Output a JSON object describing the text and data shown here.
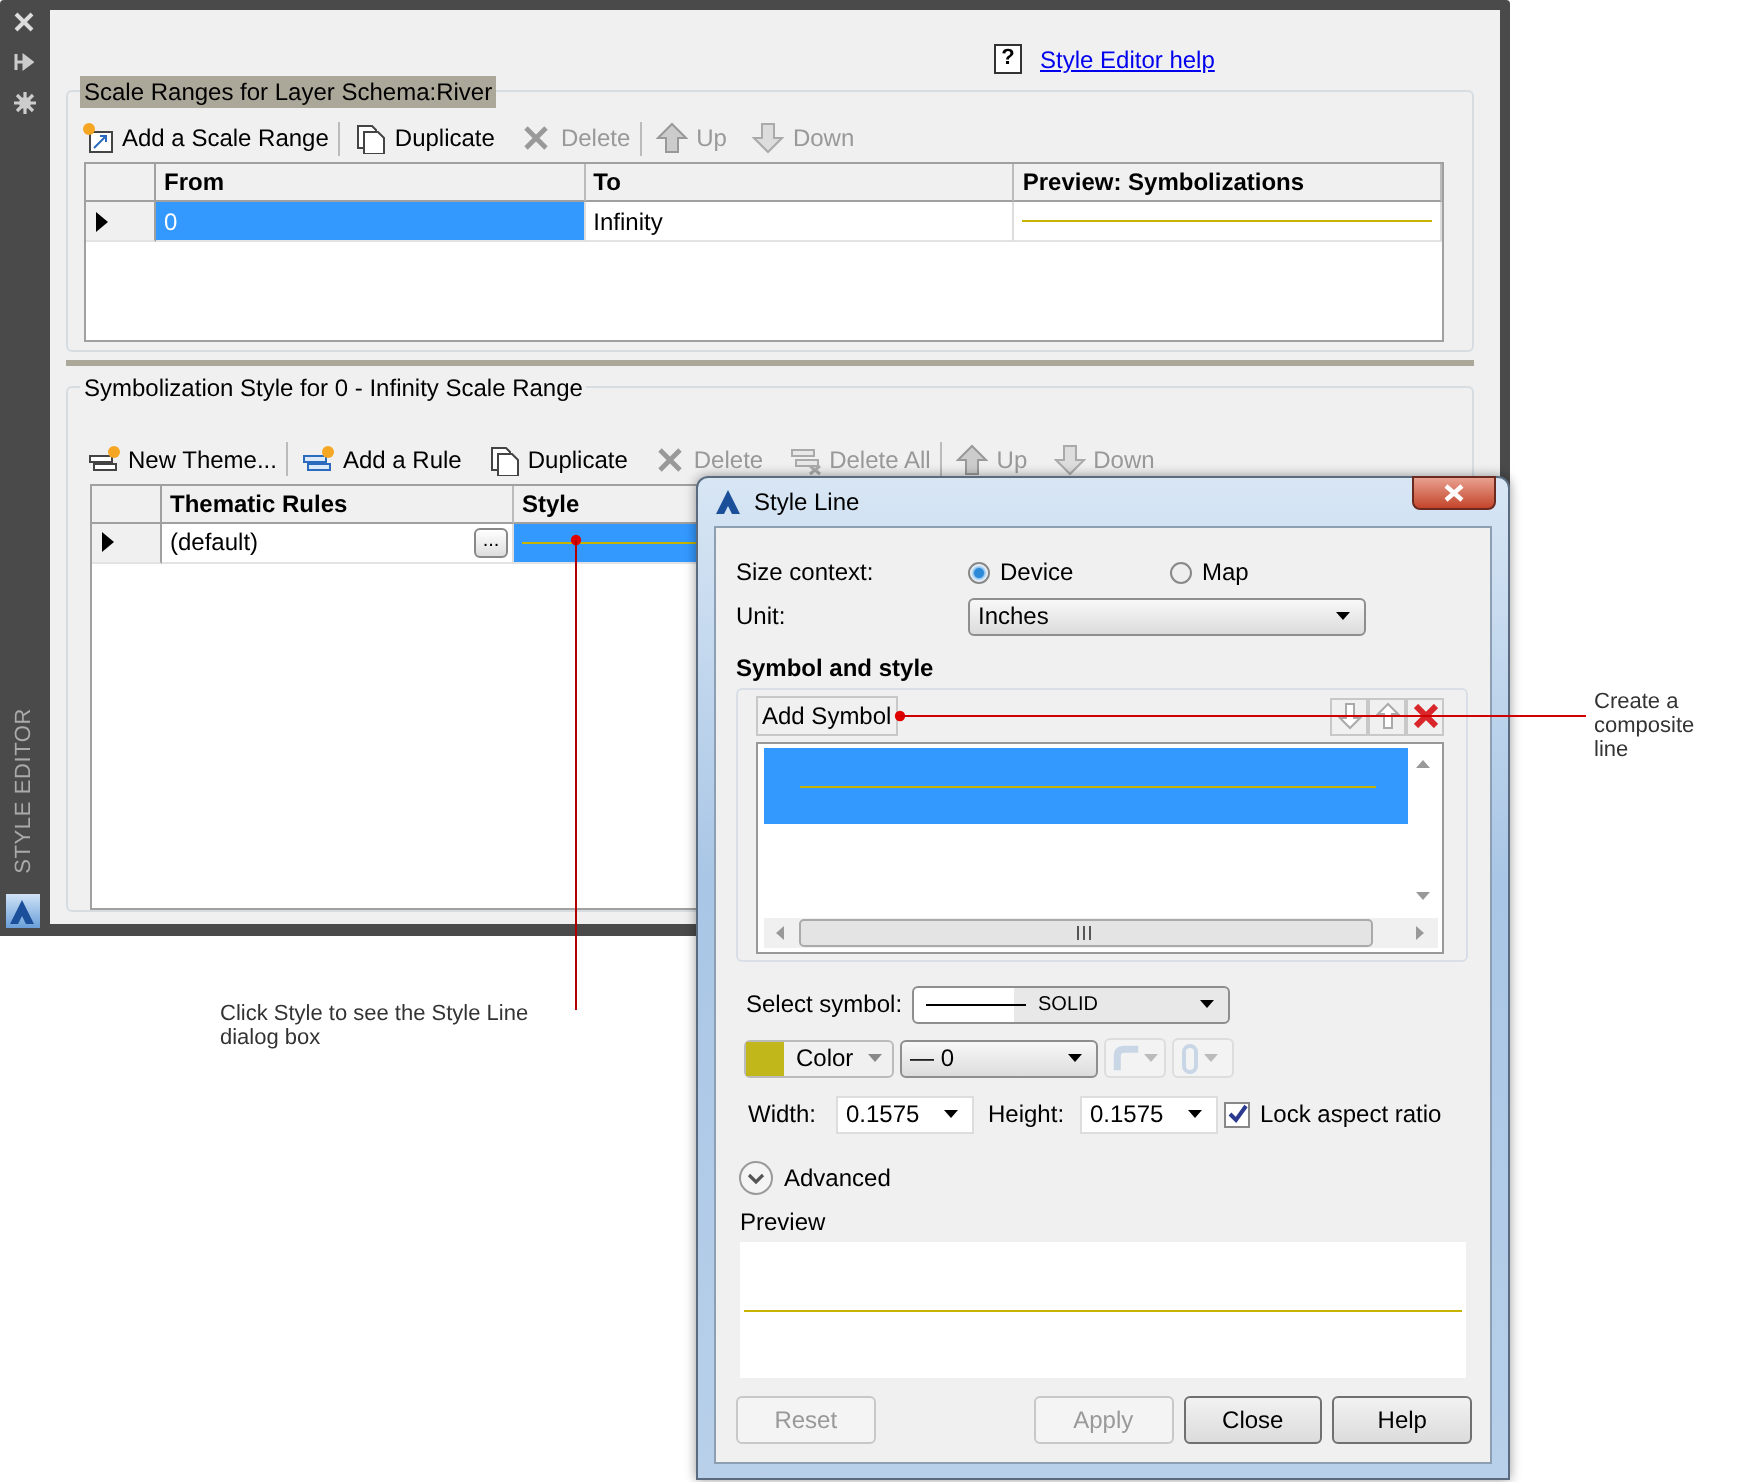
{
  "side_strip": {
    "label": "STYLE EDITOR"
  },
  "help": {
    "icon": "?",
    "link": "Style Editor help"
  },
  "scale_ranges": {
    "title": "Scale Ranges for Layer Schema:River",
    "toolbar": [
      {
        "kind": "add_range",
        "label": "Add a Scale Range",
        "disabled": false,
        "separator_after": true
      },
      {
        "kind": "duplicate",
        "label": "Duplicate",
        "disabled": false,
        "separator_after": false
      },
      {
        "kind": "delete",
        "label": "Delete",
        "disabled": true,
        "separator_after": true
      },
      {
        "kind": "up",
        "label": "Up",
        "disabled": true,
        "separator_after": false
      },
      {
        "kind": "down",
        "label": "Down",
        "disabled": true,
        "separator_after": false
      }
    ],
    "columns": [
      "From",
      "To",
      "Preview: Symbolizations"
    ],
    "rows": [
      {
        "selected": true,
        "cells": [
          {
            "kind": "text",
            "text": "0",
            "selected": true
          },
          {
            "kind": "text",
            "text": "Infinity",
            "selected": false
          },
          {
            "kind": "line",
            "selected": false
          }
        ]
      }
    ]
  },
  "symbolization": {
    "title": "Symbolization Style for 0 - Infinity Scale Range",
    "toolbar": [
      {
        "kind": "new_theme",
        "label": "New Theme...",
        "disabled": false,
        "separator_after": true
      },
      {
        "kind": "add_rule",
        "label": "Add a Rule",
        "disabled": false,
        "separator_after": false
      },
      {
        "kind": "duplicate",
        "label": "Duplicate",
        "disabled": false,
        "separator_after": false
      },
      {
        "kind": "delete",
        "label": "Delete",
        "disabled": true,
        "separator_after": false
      },
      {
        "kind": "delete_all",
        "label": "Delete All",
        "disabled": true,
        "separator_after": true
      },
      {
        "kind": "up",
        "label": "Up",
        "disabled": true,
        "separator_after": false
      },
      {
        "kind": "down",
        "label": "Down",
        "disabled": true,
        "separator_after": false
      }
    ],
    "columns": [
      "Thematic Rules",
      "Style"
    ],
    "rows": [
      {
        "selected": true,
        "cells": [
          {
            "kind": "text",
            "text": "(default)",
            "button": "...",
            "selected": false
          },
          {
            "kind": "line",
            "selected": true
          }
        ]
      }
    ]
  },
  "dialog": {
    "title": "Style Line",
    "size_context": {
      "label": "Size context:",
      "options": [
        {
          "label": "Device",
          "selected": true
        },
        {
          "label": "Map",
          "selected": false
        }
      ]
    },
    "unit": {
      "label": "Unit:",
      "value": "Inches"
    },
    "symbol_section": {
      "heading": "Symbol and style",
      "add_button": "Add Symbol",
      "symbols": [
        {
          "selected": true
        }
      ]
    },
    "select_symbol": {
      "label": "Select symbol:",
      "value": "SOLID"
    },
    "color": {
      "label": "Color"
    },
    "line_weight": {
      "value": "— 0"
    },
    "extra_dropdowns": [
      {
        "kind": "join",
        "disabled": true
      },
      {
        "kind": "cap",
        "disabled": true
      }
    ],
    "width": {
      "label": "Width:",
      "value": "0.1575"
    },
    "height": {
      "label": "Height:",
      "value": "0.1575"
    },
    "lock_aspect": {
      "label": "Lock aspect ratio",
      "checked": true
    },
    "advanced": {
      "label": "Advanced",
      "expanded": false
    },
    "preview": {
      "label": "Preview"
    },
    "buttons": [
      {
        "label": "Reset",
        "disabled": true
      },
      {
        "label": "Apply",
        "disabled": true
      },
      {
        "label": "Close",
        "disabled": false
      },
      {
        "label": "Help",
        "disabled": false
      }
    ]
  },
  "callouts": [
    {
      "kind": "symbol",
      "text": "Create a composite line"
    },
    {
      "kind": "style",
      "text": "Click Style to see the Style Line dialog box"
    }
  ]
}
